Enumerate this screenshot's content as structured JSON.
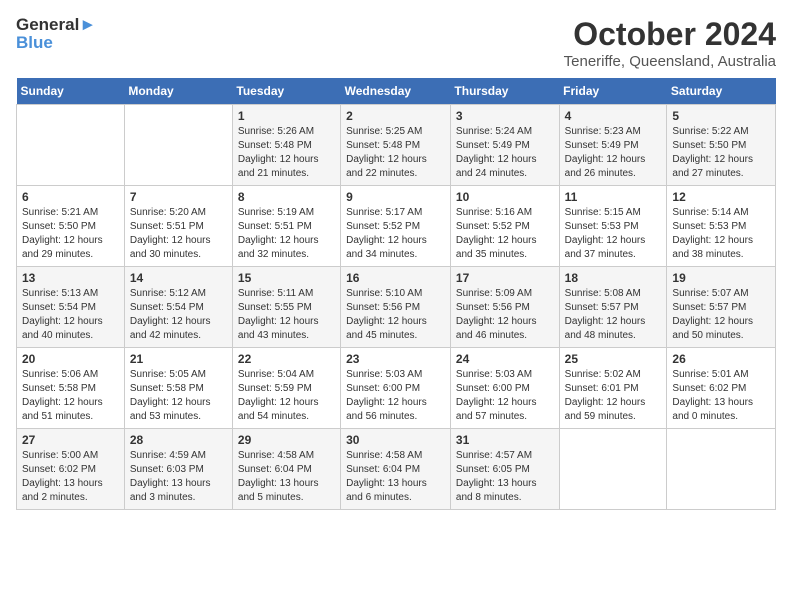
{
  "logo": {
    "line1": "General",
    "line2": "Blue"
  },
  "title": "October 2024",
  "location": "Teneriffe, Queensland, Australia",
  "days_of_week": [
    "Sunday",
    "Monday",
    "Tuesday",
    "Wednesday",
    "Thursday",
    "Friday",
    "Saturday"
  ],
  "weeks": [
    [
      {
        "num": "",
        "info": ""
      },
      {
        "num": "",
        "info": ""
      },
      {
        "num": "1",
        "info": "Sunrise: 5:26 AM\nSunset: 5:48 PM\nDaylight: 12 hours\nand 21 minutes."
      },
      {
        "num": "2",
        "info": "Sunrise: 5:25 AM\nSunset: 5:48 PM\nDaylight: 12 hours\nand 22 minutes."
      },
      {
        "num": "3",
        "info": "Sunrise: 5:24 AM\nSunset: 5:49 PM\nDaylight: 12 hours\nand 24 minutes."
      },
      {
        "num": "4",
        "info": "Sunrise: 5:23 AM\nSunset: 5:49 PM\nDaylight: 12 hours\nand 26 minutes."
      },
      {
        "num": "5",
        "info": "Sunrise: 5:22 AM\nSunset: 5:50 PM\nDaylight: 12 hours\nand 27 minutes."
      }
    ],
    [
      {
        "num": "6",
        "info": "Sunrise: 5:21 AM\nSunset: 5:50 PM\nDaylight: 12 hours\nand 29 minutes."
      },
      {
        "num": "7",
        "info": "Sunrise: 5:20 AM\nSunset: 5:51 PM\nDaylight: 12 hours\nand 30 minutes."
      },
      {
        "num": "8",
        "info": "Sunrise: 5:19 AM\nSunset: 5:51 PM\nDaylight: 12 hours\nand 32 minutes."
      },
      {
        "num": "9",
        "info": "Sunrise: 5:17 AM\nSunset: 5:52 PM\nDaylight: 12 hours\nand 34 minutes."
      },
      {
        "num": "10",
        "info": "Sunrise: 5:16 AM\nSunset: 5:52 PM\nDaylight: 12 hours\nand 35 minutes."
      },
      {
        "num": "11",
        "info": "Sunrise: 5:15 AM\nSunset: 5:53 PM\nDaylight: 12 hours\nand 37 minutes."
      },
      {
        "num": "12",
        "info": "Sunrise: 5:14 AM\nSunset: 5:53 PM\nDaylight: 12 hours\nand 38 minutes."
      }
    ],
    [
      {
        "num": "13",
        "info": "Sunrise: 5:13 AM\nSunset: 5:54 PM\nDaylight: 12 hours\nand 40 minutes."
      },
      {
        "num": "14",
        "info": "Sunrise: 5:12 AM\nSunset: 5:54 PM\nDaylight: 12 hours\nand 42 minutes."
      },
      {
        "num": "15",
        "info": "Sunrise: 5:11 AM\nSunset: 5:55 PM\nDaylight: 12 hours\nand 43 minutes."
      },
      {
        "num": "16",
        "info": "Sunrise: 5:10 AM\nSunset: 5:56 PM\nDaylight: 12 hours\nand 45 minutes."
      },
      {
        "num": "17",
        "info": "Sunrise: 5:09 AM\nSunset: 5:56 PM\nDaylight: 12 hours\nand 46 minutes."
      },
      {
        "num": "18",
        "info": "Sunrise: 5:08 AM\nSunset: 5:57 PM\nDaylight: 12 hours\nand 48 minutes."
      },
      {
        "num": "19",
        "info": "Sunrise: 5:07 AM\nSunset: 5:57 PM\nDaylight: 12 hours\nand 50 minutes."
      }
    ],
    [
      {
        "num": "20",
        "info": "Sunrise: 5:06 AM\nSunset: 5:58 PM\nDaylight: 12 hours\nand 51 minutes."
      },
      {
        "num": "21",
        "info": "Sunrise: 5:05 AM\nSunset: 5:58 PM\nDaylight: 12 hours\nand 53 minutes."
      },
      {
        "num": "22",
        "info": "Sunrise: 5:04 AM\nSunset: 5:59 PM\nDaylight: 12 hours\nand 54 minutes."
      },
      {
        "num": "23",
        "info": "Sunrise: 5:03 AM\nSunset: 6:00 PM\nDaylight: 12 hours\nand 56 minutes."
      },
      {
        "num": "24",
        "info": "Sunrise: 5:03 AM\nSunset: 6:00 PM\nDaylight: 12 hours\nand 57 minutes."
      },
      {
        "num": "25",
        "info": "Sunrise: 5:02 AM\nSunset: 6:01 PM\nDaylight: 12 hours\nand 59 minutes."
      },
      {
        "num": "26",
        "info": "Sunrise: 5:01 AM\nSunset: 6:02 PM\nDaylight: 13 hours\nand 0 minutes."
      }
    ],
    [
      {
        "num": "27",
        "info": "Sunrise: 5:00 AM\nSunset: 6:02 PM\nDaylight: 13 hours\nand 2 minutes."
      },
      {
        "num": "28",
        "info": "Sunrise: 4:59 AM\nSunset: 6:03 PM\nDaylight: 13 hours\nand 3 minutes."
      },
      {
        "num": "29",
        "info": "Sunrise: 4:58 AM\nSunset: 6:04 PM\nDaylight: 13 hours\nand 5 minutes."
      },
      {
        "num": "30",
        "info": "Sunrise: 4:58 AM\nSunset: 6:04 PM\nDaylight: 13 hours\nand 6 minutes."
      },
      {
        "num": "31",
        "info": "Sunrise: 4:57 AM\nSunset: 6:05 PM\nDaylight: 13 hours\nand 8 minutes."
      },
      {
        "num": "",
        "info": ""
      },
      {
        "num": "",
        "info": ""
      }
    ]
  ]
}
